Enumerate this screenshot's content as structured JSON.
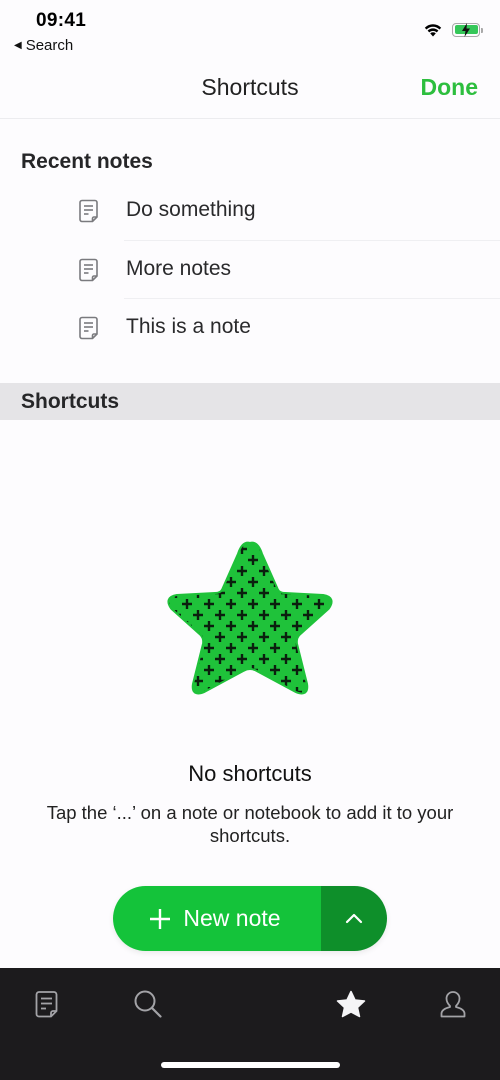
{
  "status_bar": {
    "time": "09:41",
    "back_label": "Search",
    "icons": [
      "wifi-icon",
      "battery-charging-icon"
    ]
  },
  "navbar": {
    "title": "Shortcuts",
    "done_label": "Done"
  },
  "recent_notes": {
    "header": "Recent notes",
    "items": [
      {
        "title": "Do something",
        "icon": "note-icon"
      },
      {
        "title": "More notes",
        "icon": "note-icon"
      },
      {
        "title": "This is a note",
        "icon": "note-icon"
      }
    ]
  },
  "shortcuts_section": {
    "header": "Shortcuts",
    "empty_state": {
      "illustration": "star-illustration",
      "title": "No shortcuts",
      "message": "Tap the ‘...’ on a note or notebook to add it to your shortcuts."
    }
  },
  "new_note_button": {
    "label": "New note",
    "icon": "plus-icon",
    "more_icon": "chevron-up-icon"
  },
  "tab_bar": {
    "tabs": [
      {
        "name": "notes",
        "icon": "note-icon",
        "active": false
      },
      {
        "name": "search",
        "icon": "search-icon",
        "active": false
      },
      {
        "name": "shortcuts",
        "icon": "star-icon",
        "active": true
      },
      {
        "name": "account",
        "icon": "user-icon",
        "active": false
      }
    ]
  },
  "colors": {
    "accent": "#2dbe3e",
    "button_green": "#14c33a",
    "button_green_dark": "#0e8f2a",
    "section_bg": "#e5e4e7",
    "tab_bar_bg": "#1c1b1d"
  }
}
